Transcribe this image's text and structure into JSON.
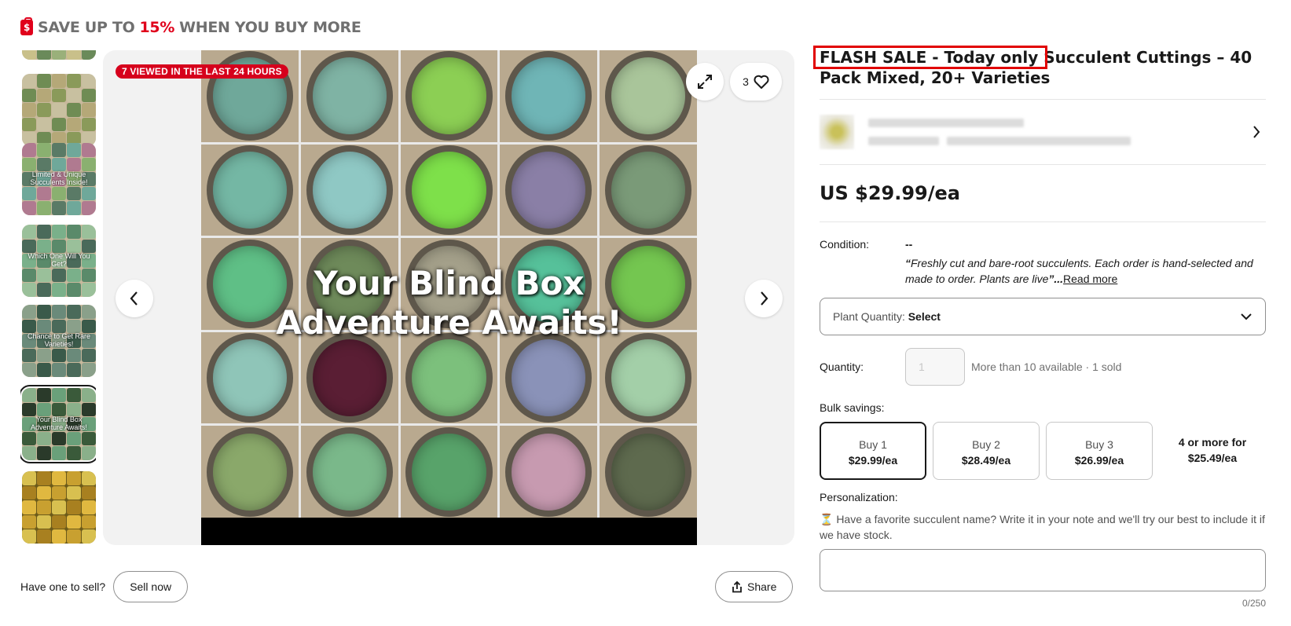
{
  "promo": {
    "prefix": "SAVE UP TO ",
    "percent": "15%",
    "suffix": " WHEN YOU BUY MORE",
    "icon": "price-tag-icon"
  },
  "thumbnails": [
    {
      "caption": ""
    },
    {
      "caption": "Limited & Unique Succulents Inside!"
    },
    {
      "caption": "Which One Will You Get?"
    },
    {
      "caption": "Chance to Get Rare Varieties!"
    },
    {
      "caption": "Your Blind Box Adventure Awaits!"
    },
    {
      "caption": ""
    }
  ],
  "gallery": {
    "viewed_badge": "7 VIEWED IN THE LAST 24 HOURS",
    "overlay_line1": "Your Blind Box",
    "overlay_line2": "Adventure Awaits!",
    "like_count": "3"
  },
  "sell": {
    "prompt": "Have one to sell?",
    "button": "Sell now"
  },
  "share": {
    "label": "Share"
  },
  "listing": {
    "title_highlight": "FLASH SALE - Today only",
    "title_rest": " Succulent Cuttings – 40 Pack Mixed, 20+ Varieties",
    "price": "US $29.99/ea",
    "condition_label": "Condition:",
    "condition_value": "--",
    "condition_desc_open": "“",
    "condition_desc": "Freshly cut and bare-root succulents. Each order is hand-selected and made to order. Plants are live",
    "condition_desc_close": "”...",
    "read_more": "Read more",
    "select_label": "Plant Quantity:",
    "select_value": "Select",
    "quantity_label": "Quantity:",
    "quantity_placeholder": "1",
    "availability": "More than 10 available · 1 sold",
    "bulk_label": "Bulk savings:",
    "tiers": [
      {
        "label": "Buy 1",
        "price": "$29.99/ea"
      },
      {
        "label": "Buy 2",
        "price": "$28.49/ea"
      },
      {
        "label": "Buy 3",
        "price": "$26.99/ea"
      },
      {
        "label": "4 or more for",
        "price": "$25.49/ea"
      }
    ],
    "personalization_label": "Personalization:",
    "personalization_desc": "⏳ Have a favorite succulent name? Write it in your note and we'll try our best to include it if we have stock.",
    "counter": "0/250"
  },
  "colors": {
    "accent_red": "#e0001b",
    "highlight_box": "#e10000"
  }
}
